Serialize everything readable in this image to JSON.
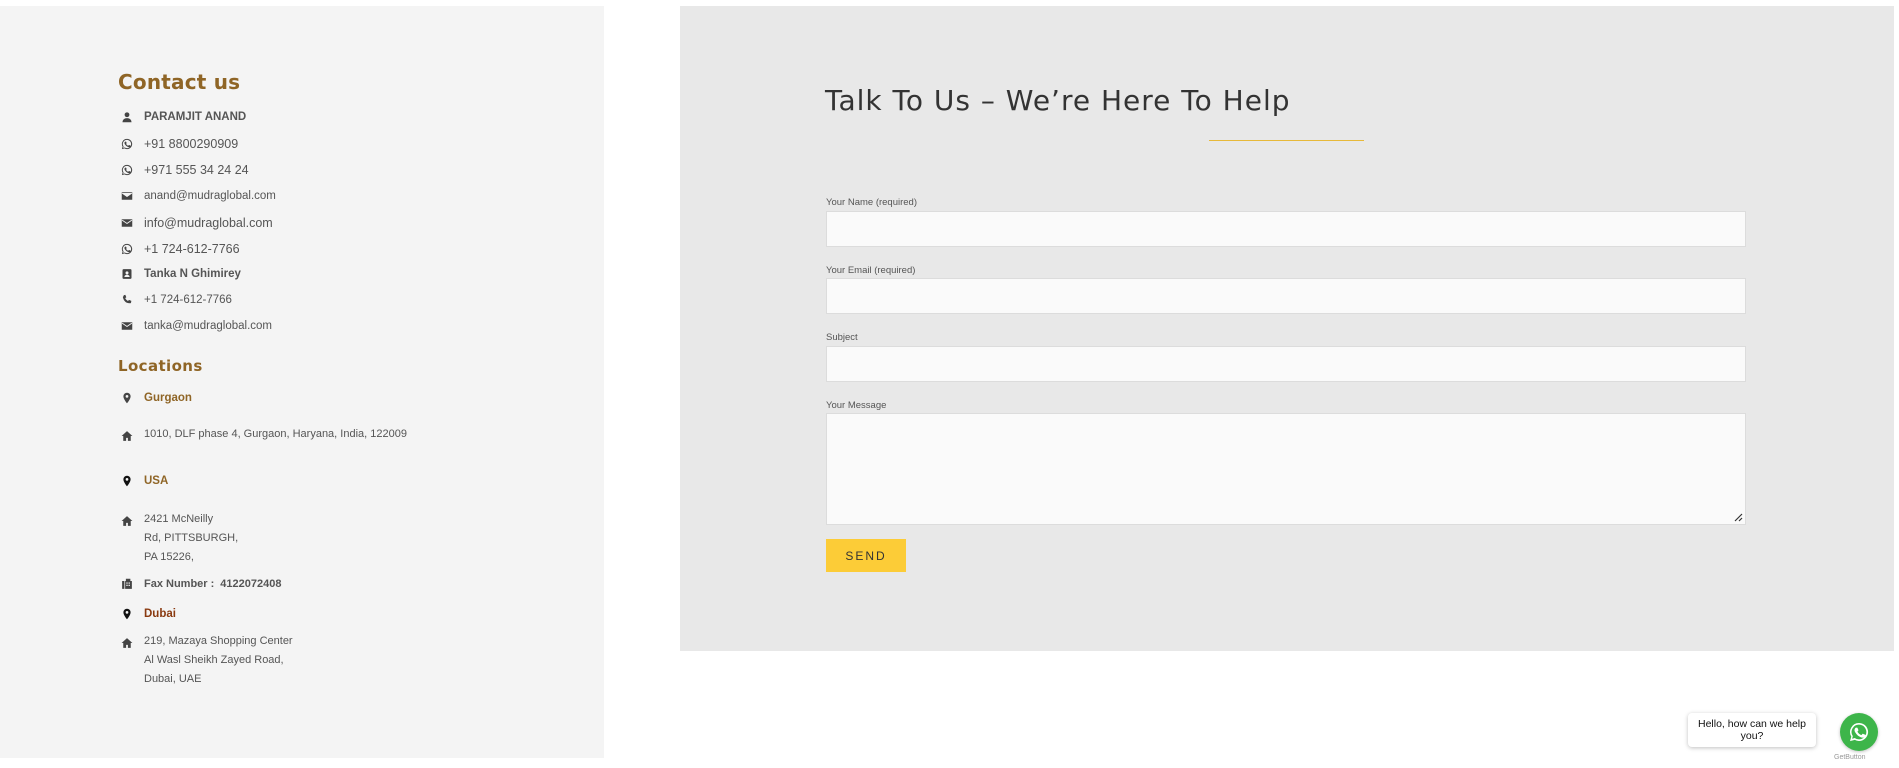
{
  "contact": {
    "title": "Contact us",
    "items": [
      {
        "icon": "person-icon",
        "text": "PARAMJIT ANAND"
      },
      {
        "icon": "whatsapp-icon",
        "text": "+91 8800290909"
      },
      {
        "icon": "whatsapp-icon",
        "text": "+971 555 34 24 24"
      },
      {
        "icon": "envelope-icon",
        "text": "anand@mudraglobal.com"
      },
      {
        "icon": "envelope-icon",
        "text": "info@mudraglobal.com"
      },
      {
        "icon": "whatsapp-icon",
        "text": "+1 724-612-7766"
      },
      {
        "icon": "contact-card-icon",
        "text": "Tanka N Ghimirey"
      },
      {
        "icon": "phone-icon",
        "text": "+1 724-612-7766"
      },
      {
        "icon": "envelope-icon",
        "text": "tanka@mudraglobal.com"
      }
    ]
  },
  "locations": {
    "title": "Locations",
    "gurgaon": {
      "name": "Gurgaon",
      "address": [
        "1010, DLF phase 4, Gurgaon, Haryana, India, 122009"
      ]
    },
    "usa": {
      "name": "USA",
      "address": [
        "2421 McNeilly",
        "Rd, PITTSBURGH,",
        "PA 15226,"
      ],
      "fax_label": "Fax Number :",
      "fax_number": "4122072408"
    },
    "dubai": {
      "name": "Dubai",
      "address": [
        "219, Mazaya Shopping Center",
        "Al Wasl Sheikh Zayed Road,",
        "Dubai, UAE"
      ]
    }
  },
  "form": {
    "title": "Talk To Us – We’re Here To Help",
    "name_label": "Your Name (required)",
    "email_label": "Your Email (required)",
    "subject_label": "Subject",
    "message_label": "Your Message",
    "send_label": "SEND"
  },
  "chat": {
    "bubble_text": "Hello, how can we help you?",
    "powered_by": "GetButton"
  },
  "colors": {
    "accent_brown": "#8f6526",
    "button_yellow": "#fccc37",
    "whatsapp_green": "#3db54a"
  }
}
